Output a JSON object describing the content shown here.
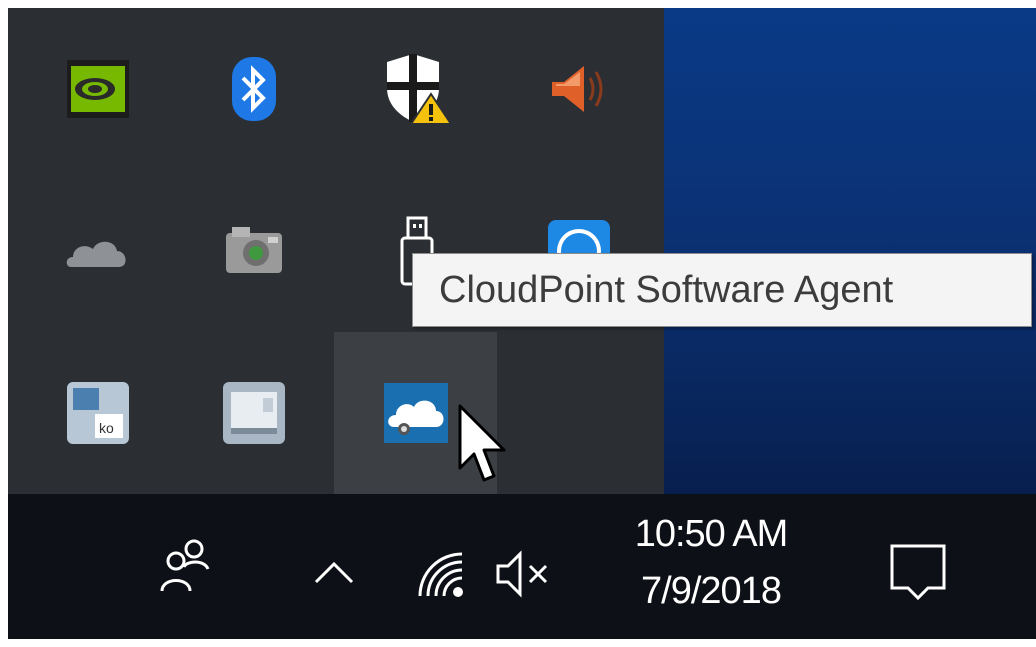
{
  "tray_flyout": {
    "icons": [
      {
        "name": "nvidia-icon",
        "row": 1,
        "col": 1
      },
      {
        "name": "bluetooth-icon",
        "row": 1,
        "col": 2
      },
      {
        "name": "windows-defender-warning-icon",
        "row": 1,
        "col": 3
      },
      {
        "name": "speaker-icon",
        "row": 1,
        "col": 4
      },
      {
        "name": "onedrive-icon",
        "row": 2,
        "col": 1
      },
      {
        "name": "camera-app-icon",
        "row": 2,
        "col": 2
      },
      {
        "name": "usb-safely-remove-icon",
        "row": 2,
        "col": 3
      },
      {
        "name": "teamviewer-icon",
        "row": 2,
        "col": 4
      },
      {
        "name": "language-icon",
        "row": 3,
        "col": 1
      },
      {
        "name": "display-app-icon",
        "row": 3,
        "col": 2
      },
      {
        "name": "cloudpoint-agent-icon",
        "row": 3,
        "col": 3,
        "hovered": true
      }
    ]
  },
  "tooltip": {
    "text": "CloudPoint Software Agent"
  },
  "taskbar": {
    "icons": [
      "people-icon",
      "show-hidden-icons-chevron",
      "wifi-icon",
      "volume-muted-icon",
      "action-center-icon"
    ],
    "clock": {
      "time": "10:50 AM",
      "date": "7/9/2018"
    }
  },
  "colors": {
    "flyout_bg": "#2b2f33",
    "taskbar_bg": "#0d1016",
    "desktop_bg": "#0b3578",
    "tooltip_bg": "#f4f4f4",
    "hover_bg": "#3c4045"
  }
}
